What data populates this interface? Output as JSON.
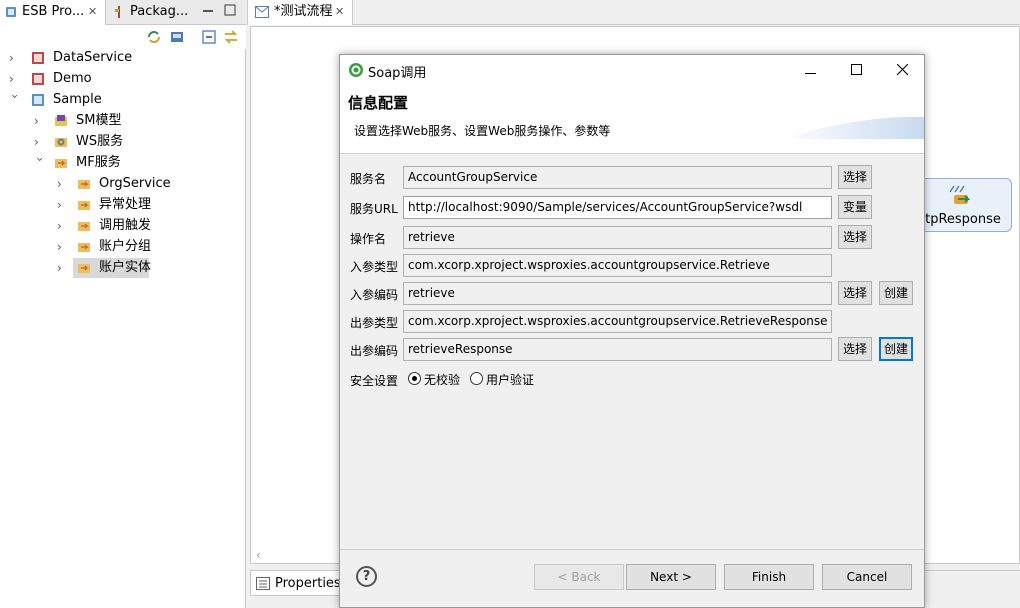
{
  "left_panel": {
    "tabs": [
      {
        "label": "ESB Pro...",
        "close": "✕"
      },
      {
        "label": "Packag...",
        "close": ""
      }
    ],
    "tree": [
      {
        "label": "DataService"
      },
      {
        "label": "Demo"
      },
      {
        "label": "Sample"
      },
      {
        "label": "SM模型"
      },
      {
        "label": "WS服务"
      },
      {
        "label": "MF服务"
      },
      {
        "label": "OrgService"
      },
      {
        "label": "异常处理"
      },
      {
        "label": "调用触发"
      },
      {
        "label": "账户分组"
      },
      {
        "label": "账户实体"
      }
    ]
  },
  "editor": {
    "tab_label": "*测试流程",
    "tab_close": "✕",
    "node_label": "ttpResponse",
    "properties_tab": "Properties"
  },
  "dialog": {
    "title": "Soap调用",
    "header_title": "信息配置",
    "header_desc": "设置选择Web服务、设置Web服务操作、参数等",
    "fields": [
      {
        "label": "服务名",
        "value": "AccountGroupService"
      },
      {
        "label": "服务URL",
        "value": "http://localhost:9090/Sample/services/AccountGroupService?wsdl"
      },
      {
        "label": "操作名",
        "value": "retrieve"
      },
      {
        "label": "入参类型",
        "value": "com.xcorp.xproject.wsproxies.accountgroupservice.Retrieve"
      },
      {
        "label": "入参编码",
        "value": "retrieve"
      },
      {
        "label": "出参类型",
        "value": "com.xcorp.xproject.wsproxies.accountgroupservice.RetrieveResponse"
      },
      {
        "label": "出参编码",
        "value": "retrieveResponse"
      }
    ],
    "buttons": {
      "select": "选择",
      "variable": "变量",
      "create": "创建"
    },
    "security": {
      "label": "安全设置",
      "options": [
        "无校验",
        "用户验证"
      ],
      "selected": "无校验"
    },
    "footer": {
      "help": "?",
      "back": "< Back",
      "next": "Next >",
      "finish": "Finish",
      "cancel": "Cancel"
    }
  }
}
